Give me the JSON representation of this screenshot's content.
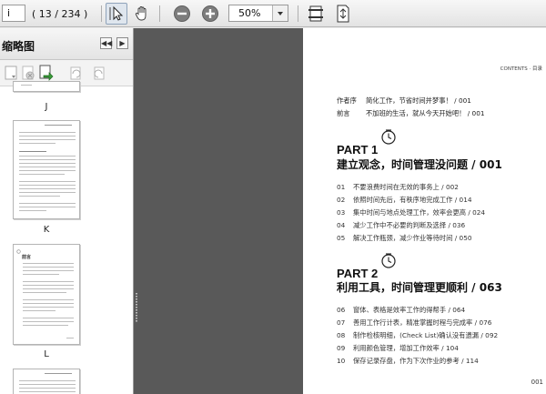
{
  "toolbar": {
    "page_input": "i",
    "page_indicator": "( 13 / 234 )",
    "zoom_value": "50%"
  },
  "sidebar": {
    "title": "缩略图",
    "thumbnails": [
      {
        "label": "J"
      },
      {
        "label": "K"
      },
      {
        "label": "L"
      }
    ],
    "thumb_preface_text": "前言"
  },
  "page": {
    "header": "CONTENTS · 目录",
    "front_matter": [
      {
        "label": "作者序",
        "text": "简化工作，节省时间并梦事！ / 001"
      },
      {
        "label": "前言",
        "text": "不加班的生活，就从今天开始吧！ / 001"
      }
    ],
    "parts": [
      {
        "part_label": "PART 1",
        "title": "建立观念，时间管理没问题 / 001",
        "items": [
          {
            "num": "01",
            "text": "不要浪费时间在无效的事务上 / 002"
          },
          {
            "num": "02",
            "text": "依照时间先后，有秩序地完成工作 / 014"
          },
          {
            "num": "03",
            "text": "集中时间与地点处理工作，效率会更高 / 024"
          },
          {
            "num": "04",
            "text": "减少工作中不必要的判断及选择 / 036"
          },
          {
            "num": "05",
            "text": "解决工作瓶颈，减少作业等待时间 / 050"
          }
        ]
      },
      {
        "part_label": "PART 2",
        "title": "利用工具，时间管理更顺利 / 063",
        "items": [
          {
            "num": "06",
            "text": "窗体、表格是效率工作的得帮手 / 064"
          },
          {
            "num": "07",
            "text": "善用工作行计表，精准掌握时程与完成率 / 076"
          },
          {
            "num": "08",
            "text": "制作检核明细，(Check List)确认没有遗漏 / 092"
          },
          {
            "num": "09",
            "text": "利用颜色管理，增加工作效率 / 104"
          },
          {
            "num": "10",
            "text": "保存记录存盘，作为下次作业的参考 / 114"
          }
        ]
      }
    ],
    "page_number": "001"
  },
  "colors": {
    "gutter": "#595959",
    "toolbar_bg": "#ececec"
  }
}
